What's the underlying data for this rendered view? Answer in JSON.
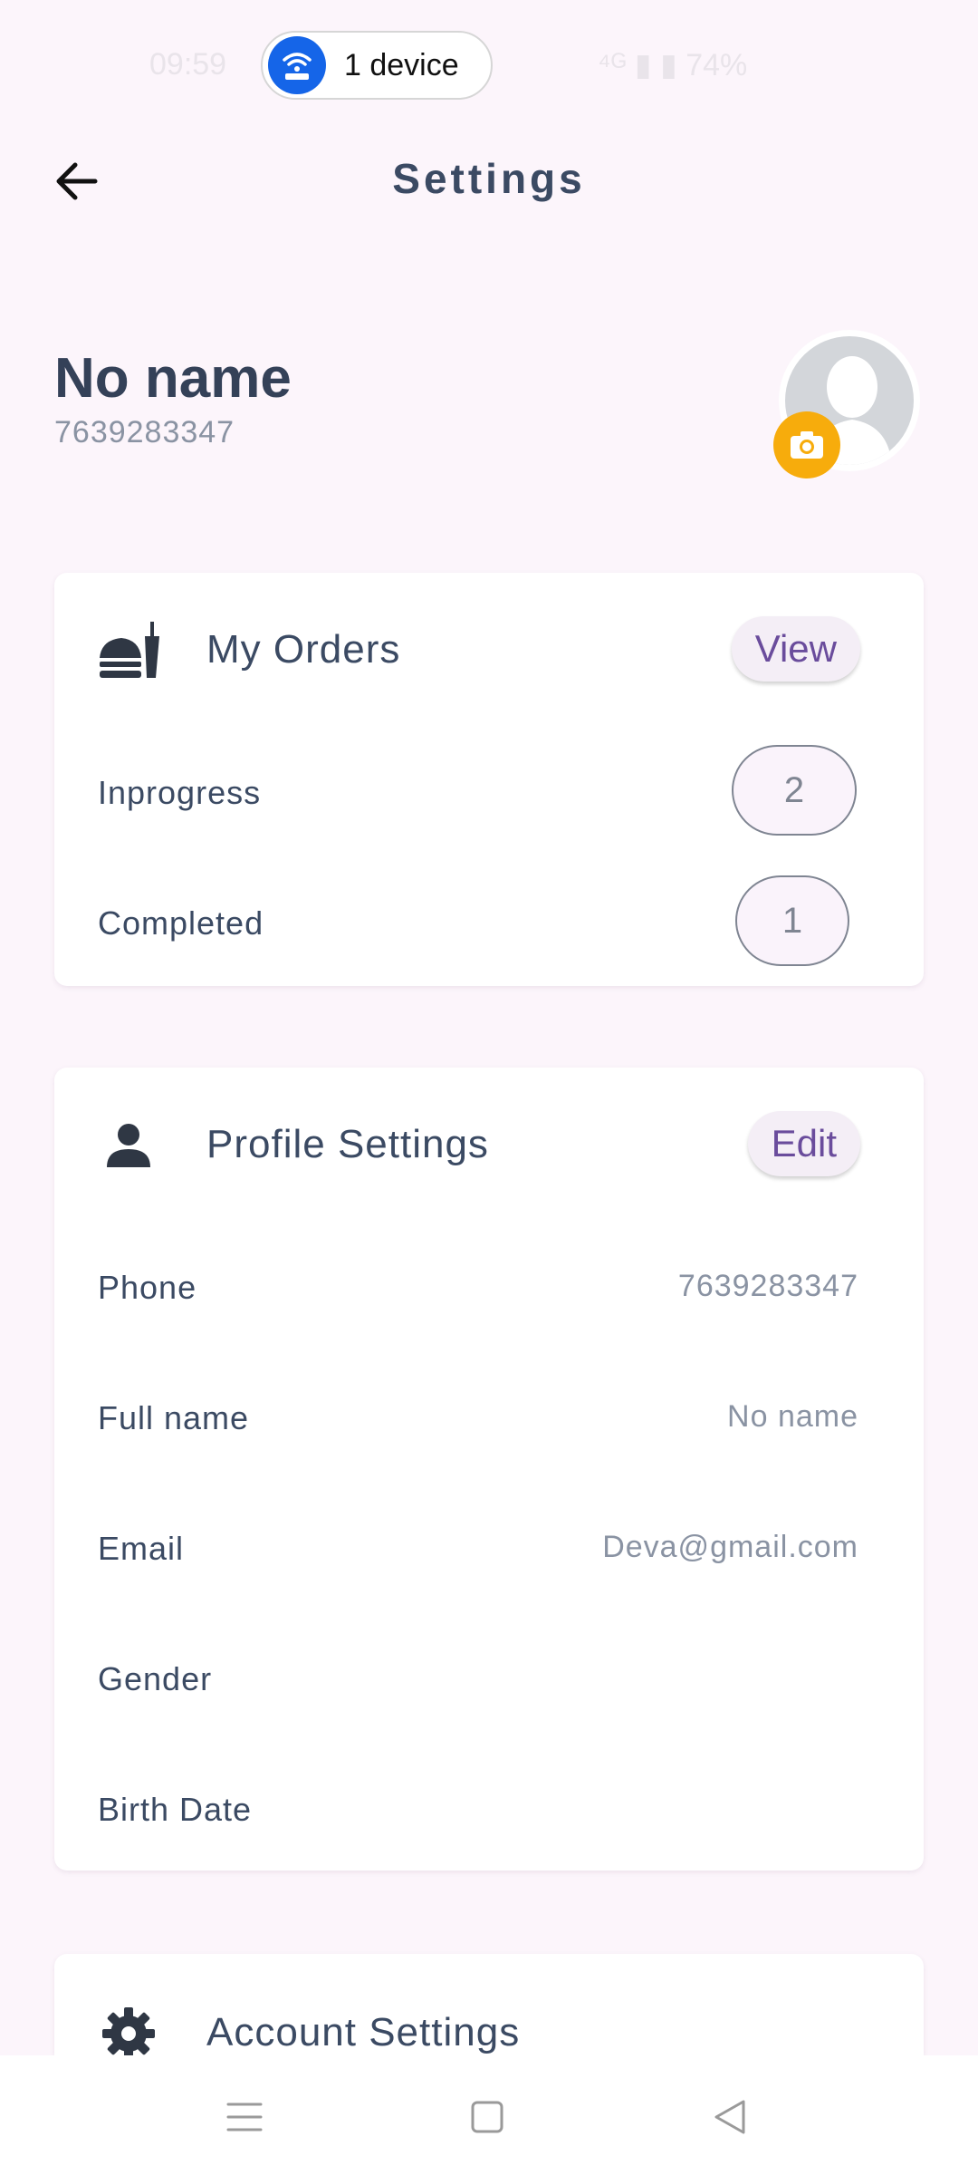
{
  "status_bar": {
    "time": "09:59",
    "hotspot_label": "1 device",
    "right_info": "⁴ᴳ ▮ ▮ 74%"
  },
  "header": {
    "title": "Settings"
  },
  "profile": {
    "name": "No name",
    "phone": "7639283347"
  },
  "orders": {
    "title": "My Orders",
    "view_label": "View",
    "inprogress_label": "Inprogress",
    "inprogress_count": "2",
    "completed_label": "Completed",
    "completed_count": "1"
  },
  "profile_settings": {
    "title": "Profile Settings",
    "edit_label": "Edit",
    "rows": [
      {
        "label": "Phone",
        "value": "7639283347"
      },
      {
        "label": "Full name",
        "value": "No name"
      },
      {
        "label": "Email",
        "value": "Deva@gmail.com"
      },
      {
        "label": "Gender",
        "value": ""
      },
      {
        "label": "Birth Date",
        "value": ""
      }
    ]
  },
  "account_settings": {
    "title": "Account Settings"
  },
  "colors": {
    "background": "#fcf5fb",
    "accent": "#6a4c9c",
    "camera_badge": "#f7ac0c",
    "hotspot_icon": "#1565e8"
  },
  "icons": {
    "back": "arrow-left-icon",
    "orders": "fastfood-icon",
    "profile": "person-icon",
    "account": "gear-icon",
    "camera": "camera-icon",
    "hotspot": "wifi-router-icon"
  }
}
